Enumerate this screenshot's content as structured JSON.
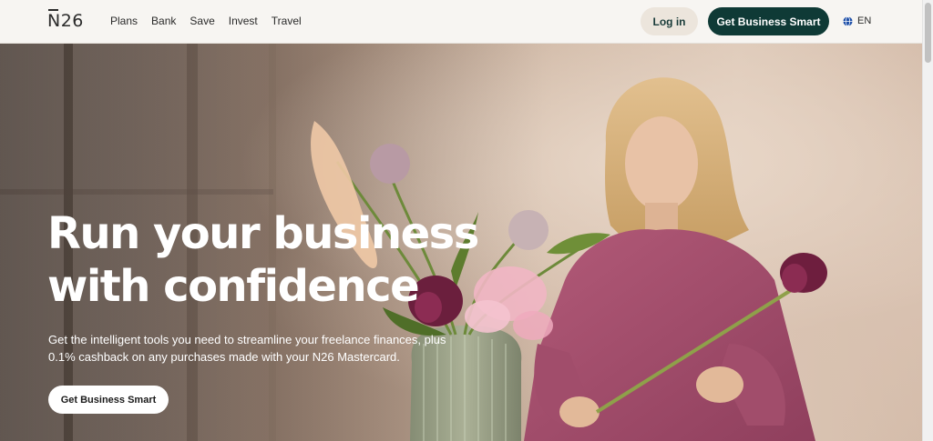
{
  "header": {
    "logo": "N26",
    "nav": [
      "Plans",
      "Bank",
      "Save",
      "Invest",
      "Travel"
    ],
    "login_label": "Log in",
    "cta_label": "Get Business Smart",
    "language": "EN"
  },
  "hero": {
    "title_line1": "Run your business",
    "title_line2": "with confidence",
    "subtitle_line1": "Get the intelligent tools you need to streamline your freelance finances, plus",
    "subtitle_line2": "0.1% cashback on any purchases made with your N26 Mastercard.",
    "cta_label": "Get Business Smart"
  },
  "colors": {
    "brand_dark": "#0f3a36",
    "login_bg": "#ece5dc",
    "header_bg": "#f7f5f2"
  },
  "icons": {
    "language": "globe-icon"
  }
}
